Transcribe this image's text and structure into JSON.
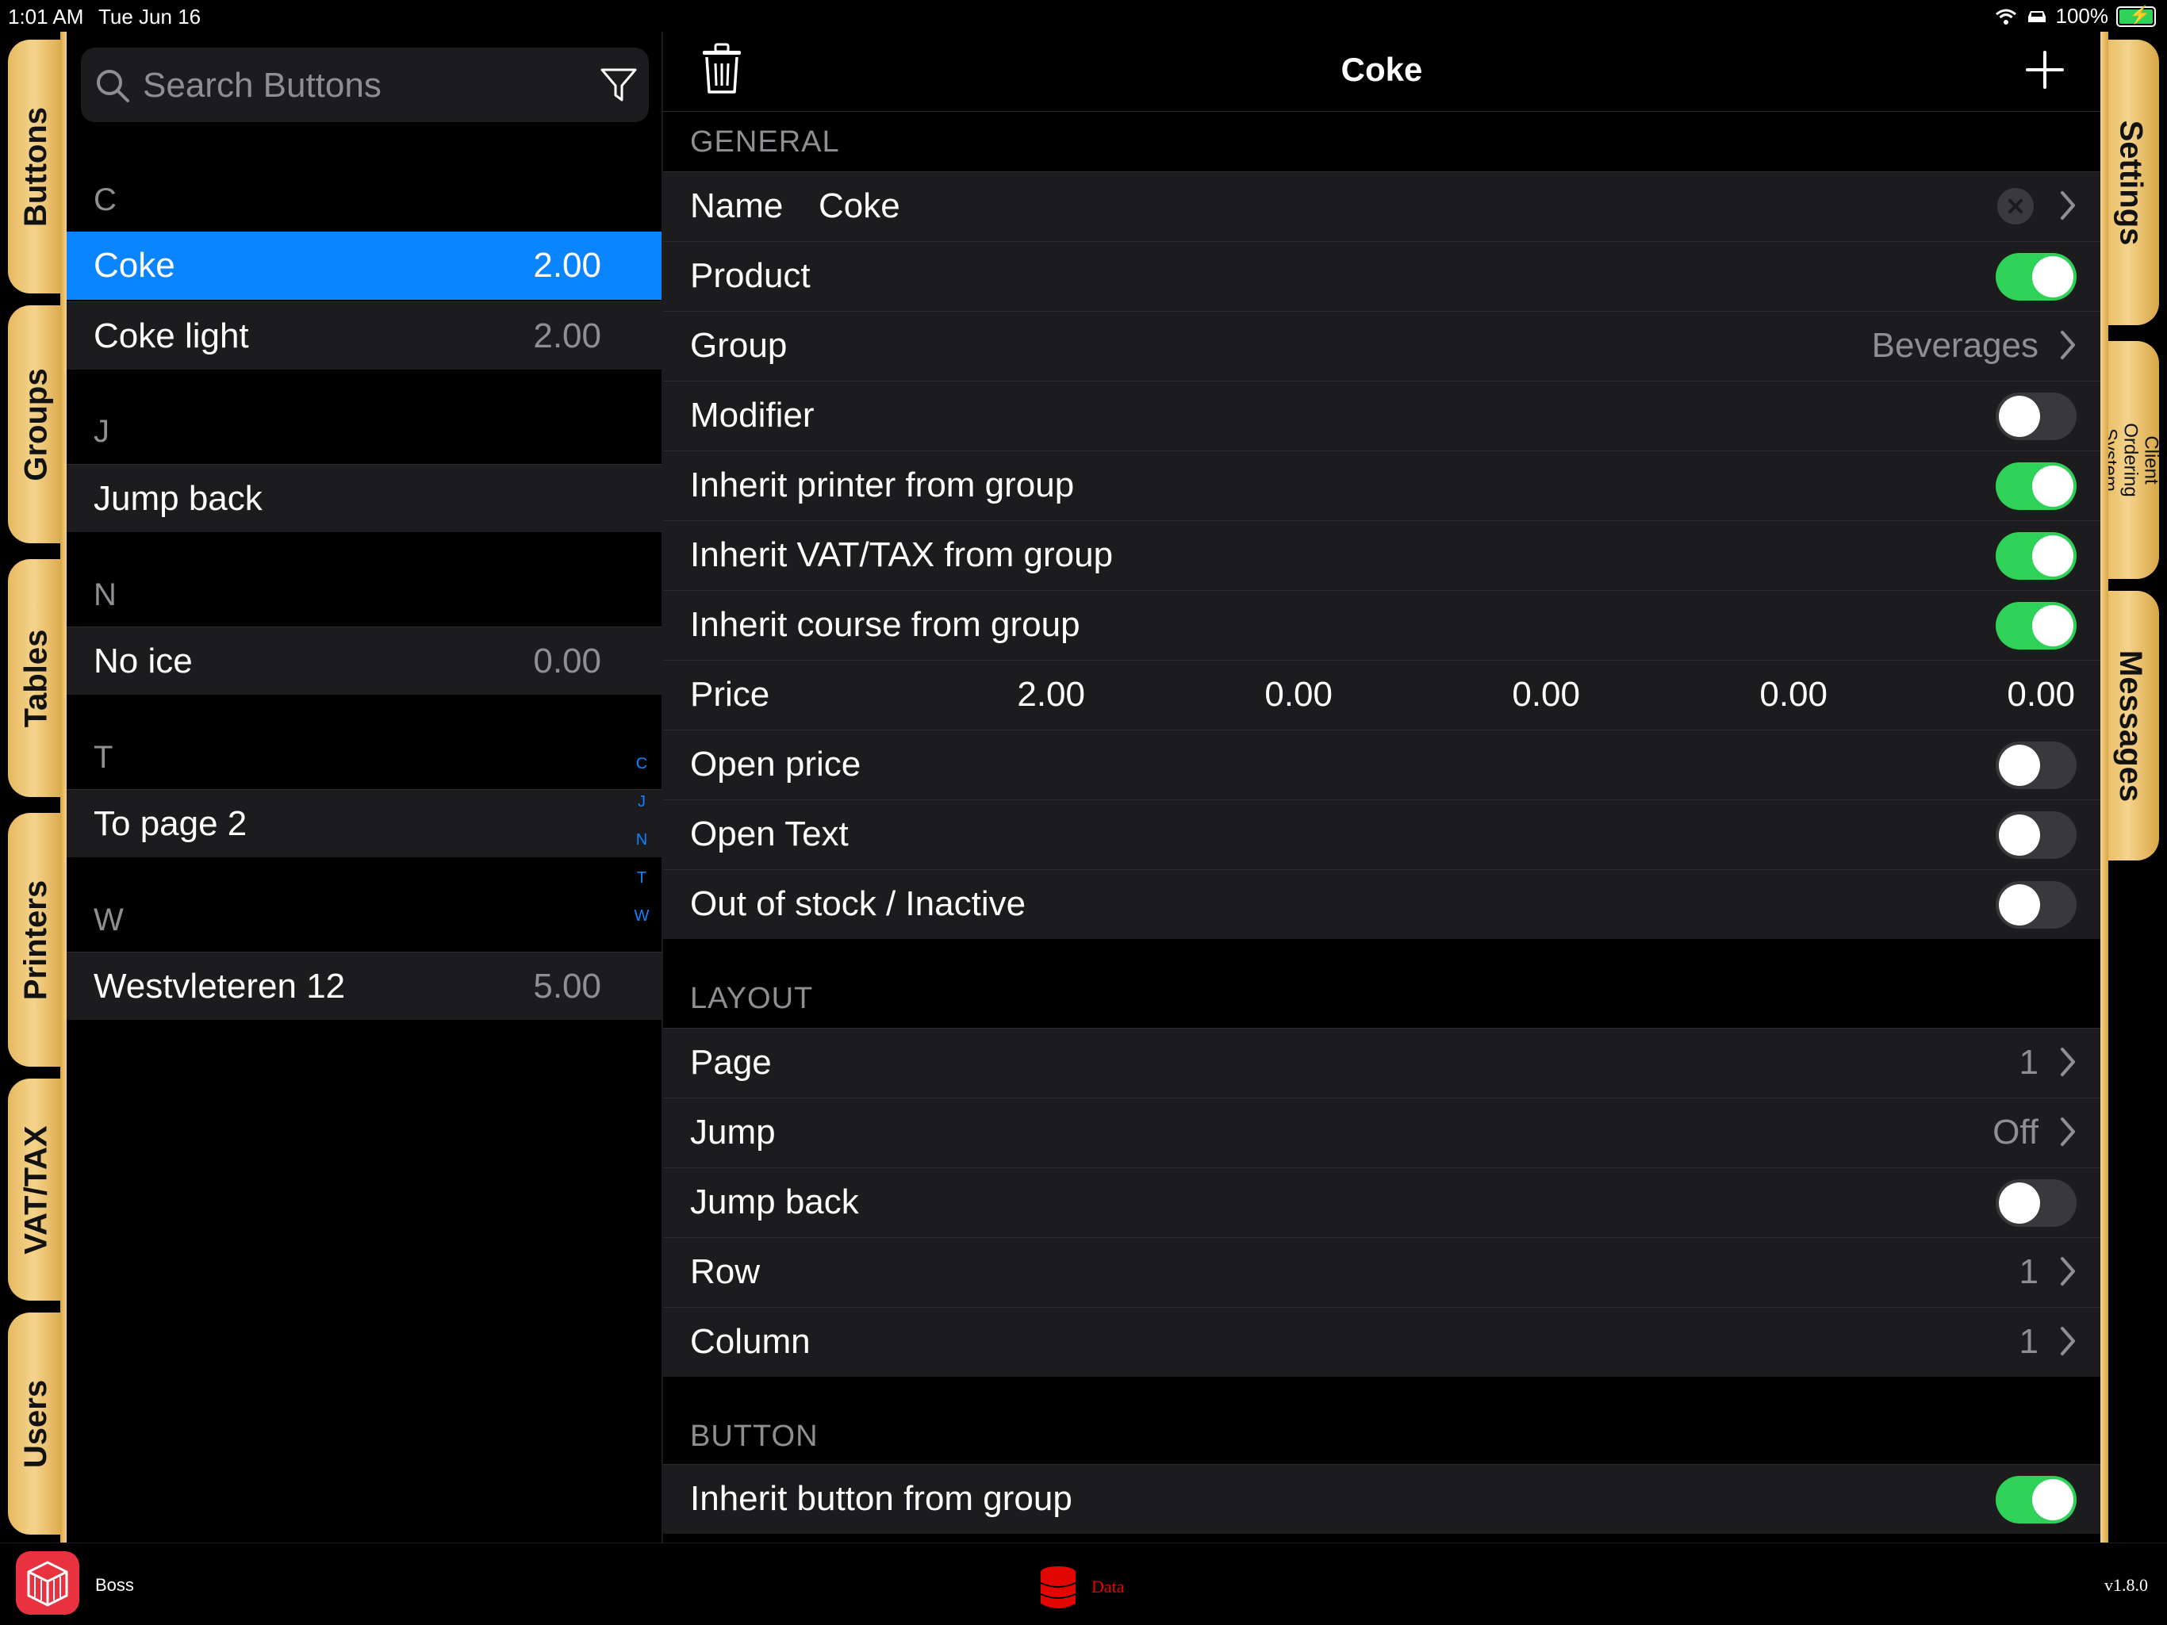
{
  "status_bar": {
    "time": "1:01 AM",
    "date": "Tue Jun 16",
    "battery": "100%"
  },
  "left_tabs": [
    "Buttons",
    "Groups",
    "Tables",
    "Printers",
    "VAT/TAX",
    "Users"
  ],
  "right_tabs": [
    "Settings",
    "Client Ordering System",
    "Messages"
  ],
  "search": {
    "placeholder": "Search Buttons"
  },
  "list": {
    "sections": [
      {
        "letter": "C",
        "items": [
          {
            "label": "Coke",
            "value": "2.00"
          },
          {
            "label": "Coke light",
            "value": "2.00"
          }
        ]
      },
      {
        "letter": "J",
        "items": [
          {
            "label": "Jump back",
            "value": ""
          }
        ]
      },
      {
        "letter": "N",
        "items": [
          {
            "label": "No ice",
            "value": "0.00"
          }
        ]
      },
      {
        "letter": "T",
        "items": [
          {
            "label": "To page 2",
            "value": ""
          }
        ]
      },
      {
        "letter": "W",
        "items": [
          {
            "label": "Westvleteren 12",
            "value": "5.00"
          }
        ]
      }
    ],
    "index": [
      "C",
      "J",
      "N",
      "T",
      "W"
    ]
  },
  "detail": {
    "title": "Coke",
    "general": {
      "header": "GENERAL",
      "name_label": "Name",
      "name_value": "Coke",
      "product": "Product",
      "group_label": "Group",
      "group_value": "Beverages",
      "modifier": "Modifier",
      "inherit_printer": "Inherit printer from group",
      "inherit_vat": "Inherit VAT/TAX from group",
      "inherit_course": "Inherit course from group",
      "price_label": "Price",
      "prices": [
        "2.00",
        "0.00",
        "0.00",
        "0.00",
        "0.00"
      ],
      "open_price": "Open price",
      "open_text": "Open Text",
      "out_of_stock": "Out of stock / Inactive"
    },
    "layout": {
      "header": "LAYOUT",
      "page_label": "Page",
      "page_value": "1",
      "jump_label": "Jump",
      "jump_value": "Off",
      "jump_back": "Jump back",
      "row_label": "Row",
      "row_value": "1",
      "column_label": "Column",
      "column_value": "1"
    },
    "button": {
      "header": "BUTTON",
      "inherit_button": "Inherit button from group"
    },
    "toggles": {
      "product": true,
      "modifier": false,
      "inherit_printer": true,
      "inherit_vat": true,
      "inherit_course": true,
      "open_price": false,
      "open_text": false,
      "out_of_stock": false,
      "jump_back": false,
      "inherit_button": true
    }
  },
  "bottom_bar": {
    "user": "Boss",
    "data_label": "Data",
    "version": "v1.8.0"
  },
  "colors": {
    "accent": "#0a84ff",
    "toggle_on": "#30d158",
    "tab_gold": "#e7b95e",
    "data_red": "#e10600"
  }
}
